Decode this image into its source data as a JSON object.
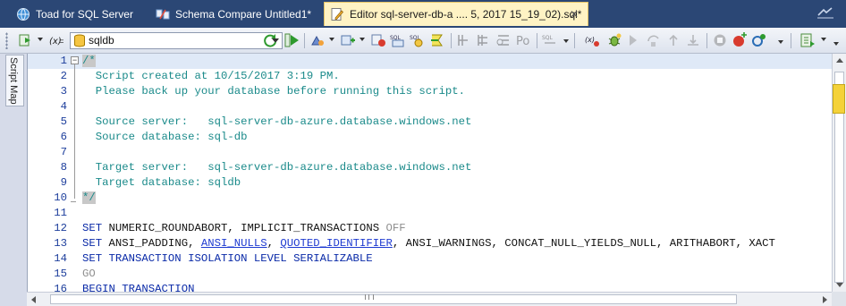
{
  "tabs": [
    {
      "label": "Toad for SQL Server",
      "icon": "globe-icon",
      "active": false
    },
    {
      "label": "Schema Compare Untitled1*",
      "icon": "schema-compare-icon",
      "active": false
    },
    {
      "label": "Editor sql-server-db-a .... 5, 2017 15_19_02).sql*",
      "icon": "editor-document-icon",
      "active": true,
      "close": "✕"
    }
  ],
  "toolbar": {
    "database": "sqldb"
  },
  "script_map": {
    "label": "Script Map"
  },
  "editor": {
    "lines": [
      {
        "n": "1",
        "segments": [
          {
            "t": "/*",
            "c": "c-comment mark-a"
          }
        ]
      },
      {
        "n": "2",
        "segments": [
          {
            "t": "  Script created at 10/15/2017 3:19 PM.",
            "c": "c-comment"
          }
        ]
      },
      {
        "n": "3",
        "segments": [
          {
            "t": "  Please back up your database before running this script.",
            "c": "c-comment"
          }
        ]
      },
      {
        "n": "4",
        "segments": []
      },
      {
        "n": "5",
        "segments": [
          {
            "t": "  Source server:   sql-server-db-azure.database.windows.net",
            "c": "c-comment"
          }
        ]
      },
      {
        "n": "6",
        "segments": [
          {
            "t": "  Source database: sql-db",
            "c": "c-comment"
          }
        ]
      },
      {
        "n": "7",
        "segments": []
      },
      {
        "n": "8",
        "segments": [
          {
            "t": "  Target server:   sql-server-db-azure.database.windows.net",
            "c": "c-comment"
          }
        ]
      },
      {
        "n": "9",
        "segments": [
          {
            "t": "  Target database: sqldb",
            "c": "c-comment"
          }
        ]
      },
      {
        "n": "10",
        "segments": [
          {
            "t": "*/",
            "c": "c-comment mark-a"
          }
        ]
      },
      {
        "n": "11",
        "segments": []
      },
      {
        "n": "12",
        "segments": [
          {
            "t": "SET",
            "c": "c-kw"
          },
          {
            "t": " NUMERIC_ROUNDABORT, IMPLICIT_TRANSACTIONS ",
            "c": "c-pl"
          },
          {
            "t": "OFF",
            "c": "c-gray"
          }
        ]
      },
      {
        "n": "13",
        "segments": [
          {
            "t": "SET",
            "c": "c-kw"
          },
          {
            "t": " ANSI_PADDING, ",
            "c": "c-pl"
          },
          {
            "t": "ANSI_NULLS",
            "c": "c-link"
          },
          {
            "t": ", ",
            "c": "c-pl"
          },
          {
            "t": "QUOTED_IDENTIFIER",
            "c": "c-link"
          },
          {
            "t": ", ANSI_WARNINGS, CONCAT_NULL_YIELDS_NULL, ARITHABORT, XACT",
            "c": "c-pl"
          }
        ]
      },
      {
        "n": "14",
        "segments": [
          {
            "t": "SET TRANSACTION ISOLATION LEVEL SERIALIZABLE",
            "c": "c-kw"
          }
        ]
      },
      {
        "n": "15",
        "segments": [
          {
            "t": "GO",
            "c": "c-gray"
          }
        ]
      },
      {
        "n": "16",
        "segments": [
          {
            "t": "BEGIN TRANSACTION",
            "c": "c-kw"
          }
        ]
      }
    ]
  },
  "colors": {
    "tabbar_bg": "#2b4775",
    "active_tab_bg": "#fff3c4",
    "line_numbers": "#1d3e9c",
    "comment": "#1a8a8a",
    "keyword": "#0a2aa8",
    "scroll_marker": "#f4d23a"
  }
}
